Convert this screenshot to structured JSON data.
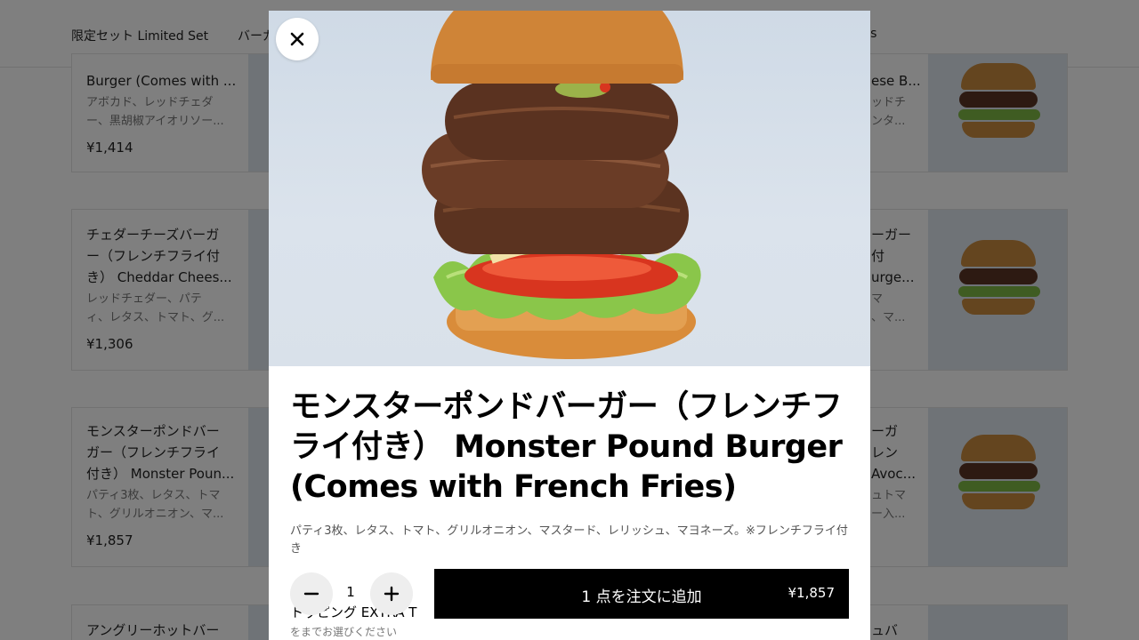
{
  "nav": {
    "tabs": [
      "限定セット Limited Set",
      "バーガー",
      "ks"
    ]
  },
  "left_cards": [
    {
      "title_lines": [
        "Burger (Comes with ..."
      ],
      "desc_lines": [
        "アボカド、レッドチェダ",
        "ー、黒胡椒アイオリソー..."
      ],
      "price": "¥1,414"
    },
    {
      "title_lines": [
        "チェダーチーズバーガ",
        "ー（フレンチフライ付",
        "き） Cheddar Chees..."
      ],
      "desc_lines": [
        "レッドチェダー、パテ",
        "ィ、レタス、トマト、グ..."
      ],
      "price": "¥1,306"
    },
    {
      "title_lines": [
        "モンスターポンドバー",
        "ガー（フレンチフライ",
        "付き） Monster Poun..."
      ],
      "desc_lines": [
        "パティ3枚、レタス、トマ",
        "ト、グリルオニオン、マ..."
      ],
      "price": "¥1,857"
    },
    {
      "title_lines": [
        "アングリーホットバー"
      ],
      "desc_lines": [],
      "price": ""
    }
  ],
  "right_cards": [
    {
      "title_lines": [
        "ese B..."
      ],
      "desc_lines": [
        "ッドチ",
        "ンタ..."
      ]
    },
    {
      "title_lines": [
        "ーガー",
        "付",
        "urge..."
      ],
      "desc_lines": [
        "マ",
        "、マ..."
      ]
    },
    {
      "title_lines": [
        "ーガ",
        "レン",
        "Avoc..."
      ],
      "desc_lines": [
        "ュトマ",
        "ー入..."
      ]
    },
    {
      "title_lines": [
        "ュバ"
      ],
      "desc_lines": []
    }
  ],
  "modal": {
    "title": "モンスターポンドバーガー（フレンチフライ付き） Monster Pound Burger (Comes with French Fries)",
    "description": "パティ3枚、レタス、トマト、グリルオニオン、マスタード、レリッシュ、マヨネーズ。※フレンチフライ付き",
    "quantity": "1",
    "add_button_label": "1 点を注文に追加",
    "add_button_price": "¥1,857",
    "below_section_title": "トッピング EXTRA T",
    "below_section_sub": "をまでお選びください"
  },
  "icons": {
    "close": "close-icon",
    "minus": "minus-icon",
    "plus": "plus-icon"
  },
  "colors": {
    "primary_button": "#000000",
    "overlay": "rgba(0,0,0,0.5)"
  }
}
